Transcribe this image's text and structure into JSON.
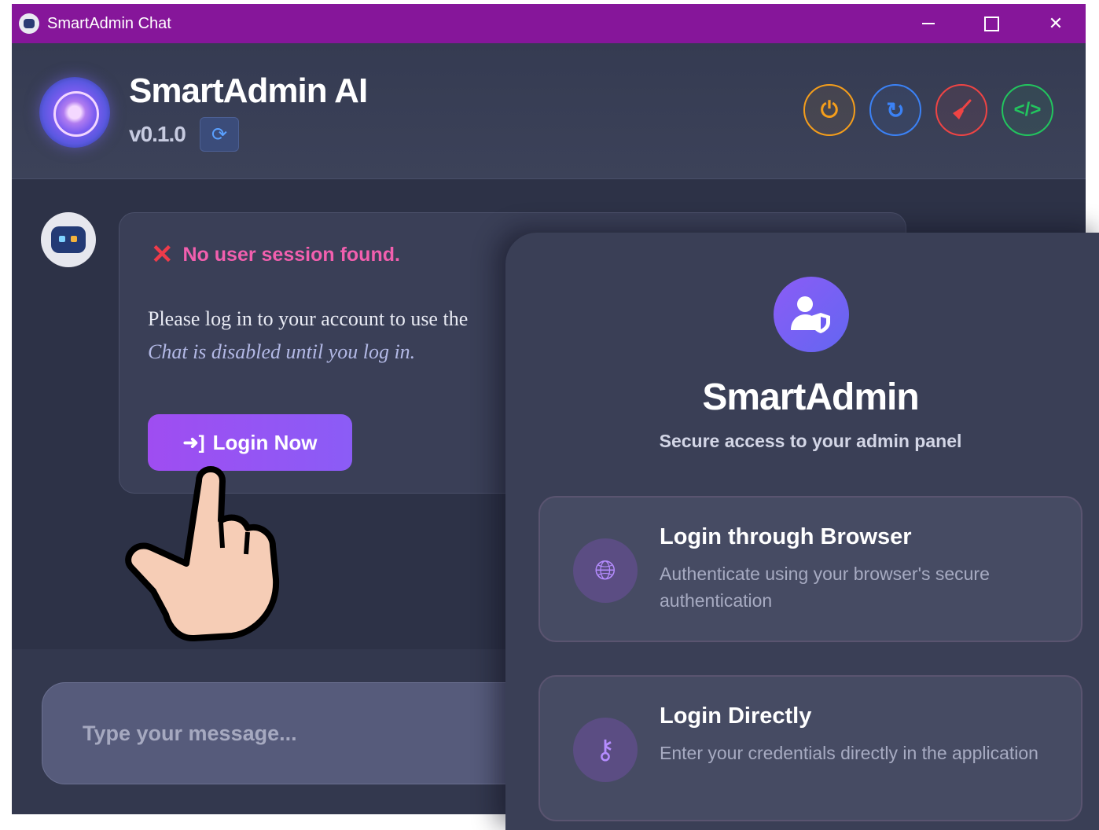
{
  "window": {
    "title": "SmartAdmin Chat"
  },
  "header": {
    "app_name": "SmartAdmin AI",
    "version": "v0.1.0",
    "buttons": [
      {
        "icon": "power-icon",
        "color": "#f59e1b"
      },
      {
        "icon": "reload-icon",
        "color": "#3b82f6"
      },
      {
        "icon": "broom-icon",
        "color": "#ef4444"
      },
      {
        "icon": "code-icon",
        "color": "#22c55e"
      }
    ]
  },
  "chat": {
    "error": "No user session found.",
    "message": "Please log in to your account to use the",
    "note": "Chat is disabled until you log in.",
    "login_button": "Login Now",
    "input_placeholder": "Type your message..."
  },
  "login_panel": {
    "title": "SmartAdmin",
    "subtitle": "Secure access to your admin panel",
    "options": [
      {
        "title": "Login through Browser",
        "description": "Authenticate using your browser's secure authentication",
        "icon": "globe-icon"
      },
      {
        "title": "Login Directly",
        "description": "Enter your credentials directly in the application",
        "icon": "key-icon"
      }
    ]
  },
  "colors": {
    "titlebar": "#86169a",
    "accent": "#8b5cf6",
    "error": "#ef3b4a",
    "error_text": "#f25fae"
  }
}
